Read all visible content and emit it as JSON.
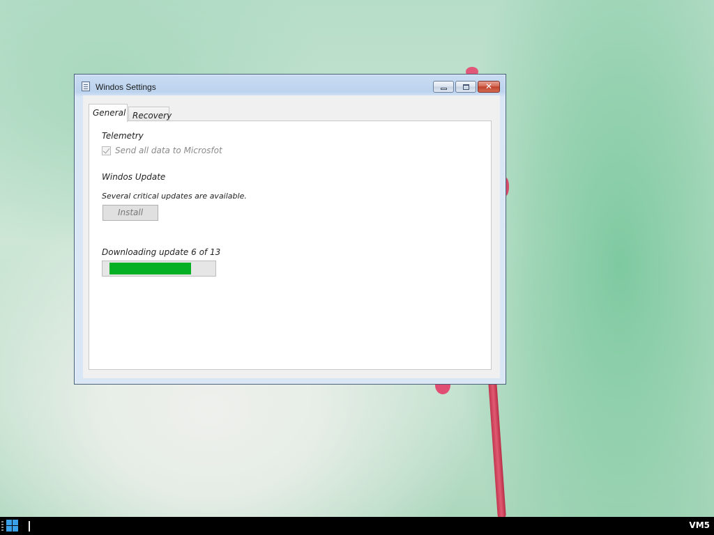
{
  "window": {
    "title": "Windos Settings"
  },
  "tabs": [
    {
      "label": "General",
      "active": true
    },
    {
      "label": "Recovery",
      "active": false
    }
  ],
  "telemetry": {
    "heading": "Telemetry",
    "checkbox_label": "Send all data to Microsfot",
    "checked": true,
    "disabled": true
  },
  "update": {
    "heading": "Windos Update",
    "message": "Several critical updates are available.",
    "install_label": "Install",
    "download_status": "Downloading update 6 of 13",
    "progress_fraction": 0.78
  },
  "taskbar": {
    "vm_label": "VM5"
  },
  "colors": {
    "progress_fill": "#06b025",
    "taskbar": "#000000",
    "start_icon": "#3aa0e8"
  },
  "icons": [
    "app-icon",
    "minimize-icon",
    "maximize-icon",
    "close-icon",
    "windows-start-icon",
    "checkmark-icon"
  ]
}
